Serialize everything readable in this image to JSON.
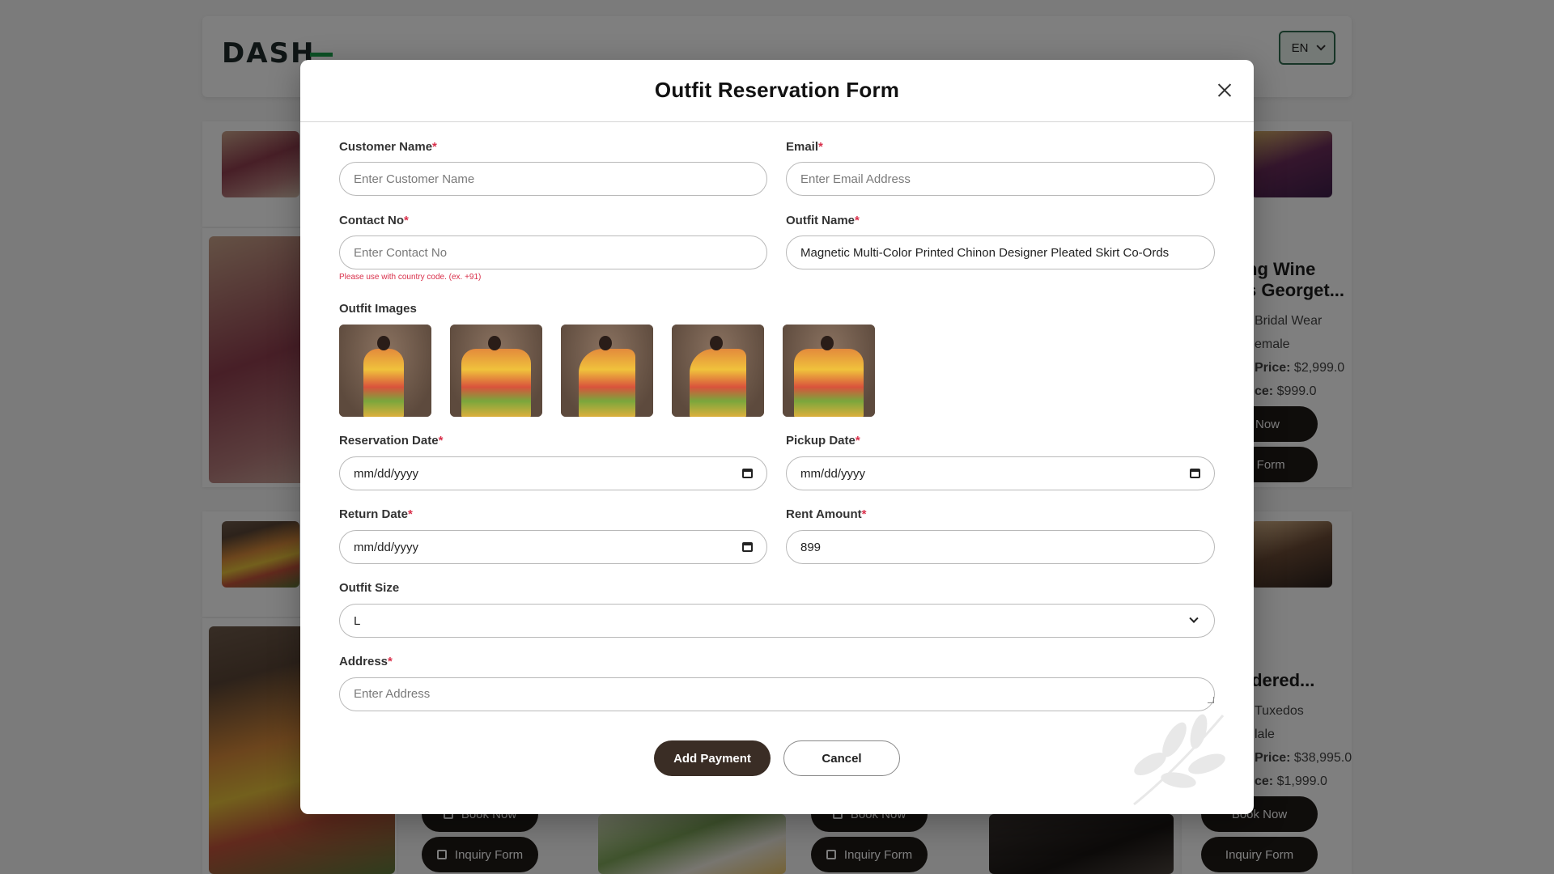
{
  "background": {
    "logo_text": "DASH",
    "lang": "EN",
    "cards": [
      {
        "title_line1": "ng Wine",
        "title_line2": "s Georget...",
        "category": "Bridal Wear",
        "gender": "emale",
        "rent_label": "Price:",
        "rent_price": "$2,999.0",
        "sale_label": "ce:",
        "sale_price": "$999.0",
        "book": "ok Now",
        "inquiry": "uiry Form"
      },
      {
        "title_line1": "idered...",
        "category": "Tuxedos",
        "gender": "lale",
        "rent_label": "Price:",
        "rent_price": "$38,995.0",
        "sale_label": "ce:",
        "sale_price": "$1,999.0",
        "book": "Book Now",
        "inquiry": "Inquiry Form"
      }
    ],
    "bottom_buttons": {
      "book": "Book Now",
      "inquiry": "Inquiry Form"
    }
  },
  "modal": {
    "title": "Outfit Reservation Form",
    "customer_name": {
      "label": "Customer Name",
      "placeholder": "Enter Customer Name",
      "value": ""
    },
    "email": {
      "label": "Email",
      "placeholder": "Enter Email Address",
      "value": ""
    },
    "contact_no": {
      "label": "Contact No",
      "placeholder": "Enter Contact No",
      "value": "",
      "hint": "Please use with country code. (ex. +91)"
    },
    "outfit_name": {
      "label": "Outfit Name",
      "value": "Magnetic Multi-Color Printed Chinon Designer Pleated Skirt Co-Ords"
    },
    "outfit_images": {
      "label": "Outfit Images",
      "count": 5
    },
    "reservation_date": {
      "label": "Reservation Date",
      "value": "mm/dd/yyyy"
    },
    "pickup_date": {
      "label": "Pickup Date",
      "value": "mm/dd/yyyy"
    },
    "return_date": {
      "label": "Return Date",
      "value": "mm/dd/yyyy"
    },
    "rent_amount": {
      "label": "Rent Amount",
      "value": "899"
    },
    "outfit_size": {
      "label": "Outfit Size",
      "value": "L"
    },
    "address": {
      "label": "Address",
      "placeholder": "Enter Address",
      "value": ""
    },
    "required_mark": "*",
    "buttons": {
      "add_payment": "Add Payment",
      "cancel": "Cancel"
    }
  },
  "colors": {
    "accent": "#3a2d25",
    "required": "#d9304b",
    "overlay": "rgba(0,0,0,0.5)"
  }
}
